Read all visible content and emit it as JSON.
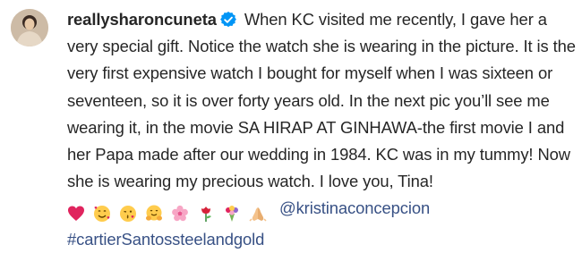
{
  "post": {
    "username": "reallysharoncuneta",
    "verified": true,
    "caption": "When KC visited me recently, I gave her a very special gift. Notice the watch she is wearing in the picture. It is the very first expensive watch I bought for myself when I was sixteen or seventeen, so it is over forty years old. In the next pic you’ll see me wearing it, in the movie SA HIRAP AT GINHAWA-the first movie I and her Papa made after our wedding in 1984. KC was in my tummy! Now she is wearing my precious watch. I love you, Tina!",
    "emojis": [
      "red-heart-emoji",
      "smiling-face-with-hearts-emoji",
      "face-blowing-kiss-emoji",
      "hugging-face-emoji",
      "cherry-blossom-emoji",
      "rose-emoji",
      "bouquet-emoji",
      "folded-hands-emoji"
    ],
    "mention": "@kristinaconcepcion",
    "hashtag": "#cartierSantossteelandgold"
  },
  "colors": {
    "text": "#262626",
    "link": "#385185",
    "verified_badge": "#0095f6"
  }
}
